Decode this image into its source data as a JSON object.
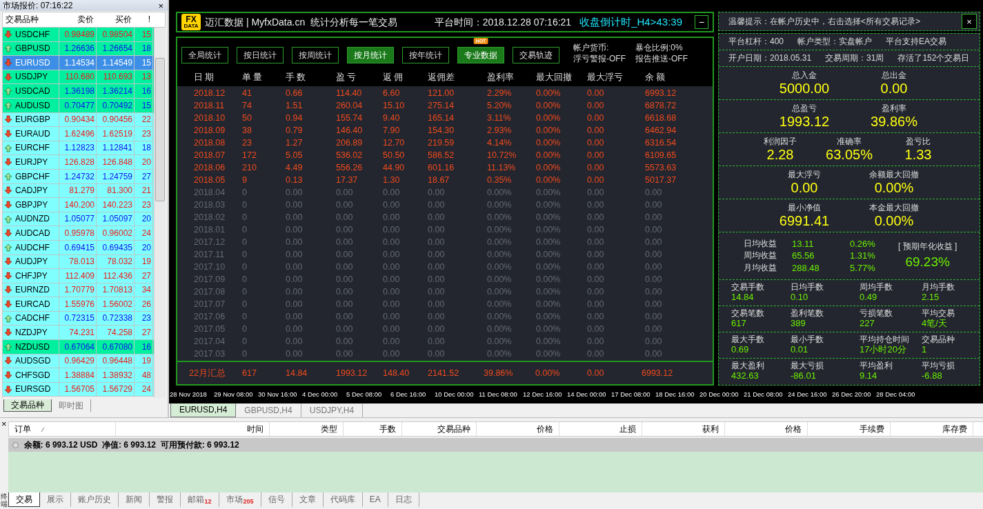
{
  "market_watch": {
    "title": "市场报价: 07:16:22",
    "close": "×",
    "columns": [
      "交易品种",
      "卖价",
      "买价",
      "!"
    ],
    "quotes": [
      {
        "symbol": "USDCHF",
        "bid": "0.98489",
        "ask": "0.98504",
        "spread": "15",
        "rising": false,
        "highlighted": true,
        "selected": false
      },
      {
        "symbol": "GBPUSD",
        "bid": "1.26636",
        "ask": "1.26654",
        "spread": "18",
        "rising": true,
        "highlighted": true,
        "selected": false
      },
      {
        "symbol": "EURUSD",
        "bid": "1.14534",
        "ask": "1.14549",
        "spread": "15",
        "rising": false,
        "selected": true
      },
      {
        "symbol": "USDJPY",
        "bid": "110.680",
        "ask": "110.693",
        "spread": "13",
        "rising": false,
        "highlighted": true,
        "selected": false
      },
      {
        "symbol": "USDCAD",
        "bid": "1.36198",
        "ask": "1.36214",
        "spread": "16",
        "rising": true,
        "highlighted": true,
        "selected": false
      },
      {
        "symbol": "AUDUSD",
        "bid": "0.70477",
        "ask": "0.70492",
        "spread": "15",
        "rising": true,
        "highlighted": true,
        "selected": false
      },
      {
        "symbol": "EURGBP",
        "bid": "0.90434",
        "ask": "0.90456",
        "spread": "22",
        "rising": false,
        "highlighted": false,
        "selected": false
      },
      {
        "symbol": "EURAUD",
        "bid": "1.62496",
        "ask": "1.62519",
        "spread": "23",
        "rising": false,
        "highlighted": false,
        "selected": false
      },
      {
        "symbol": "EURCHF",
        "bid": "1.12823",
        "ask": "1.12841",
        "spread": "18",
        "rising": true,
        "highlighted": false,
        "selected": false
      },
      {
        "symbol": "EURJPY",
        "bid": "126.828",
        "ask": "126.848",
        "spread": "20",
        "rising": false,
        "highlighted": false,
        "selected": false
      },
      {
        "symbol": "GBPCHF",
        "bid": "1.24732",
        "ask": "1.24759",
        "spread": "27",
        "rising": true,
        "highlighted": false,
        "selected": false
      },
      {
        "symbol": "CADJPY",
        "bid": "81.279",
        "ask": "81.300",
        "spread": "21",
        "rising": false,
        "highlighted": false,
        "selected": false
      },
      {
        "symbol": "GBPJPY",
        "bid": "140.200",
        "ask": "140.223",
        "spread": "23",
        "rising": false,
        "highlighted": false,
        "selected": false
      },
      {
        "symbol": "AUDNZD",
        "bid": "1.05077",
        "ask": "1.05097",
        "spread": "20",
        "rising": true,
        "highlighted": false,
        "selected": false
      },
      {
        "symbol": "AUDCAD",
        "bid": "0.95978",
        "ask": "0.96002",
        "spread": "24",
        "rising": false,
        "highlighted": false,
        "selected": false
      },
      {
        "symbol": "AUDCHF",
        "bid": "0.69415",
        "ask": "0.69435",
        "spread": "20",
        "rising": true,
        "highlighted": false,
        "selected": false
      },
      {
        "symbol": "AUDJPY",
        "bid": "78.013",
        "ask": "78.032",
        "spread": "19",
        "rising": false,
        "highlighted": false,
        "selected": false
      },
      {
        "symbol": "CHFJPY",
        "bid": "112.409",
        "ask": "112.436",
        "spread": "27",
        "rising": false,
        "highlighted": false,
        "selected": false
      },
      {
        "symbol": "EURNZD",
        "bid": "1.70779",
        "ask": "1.70813",
        "spread": "34",
        "rising": false,
        "highlighted": false,
        "selected": false
      },
      {
        "symbol": "EURCAD",
        "bid": "1.55976",
        "ask": "1.56002",
        "spread": "26",
        "rising": false,
        "highlighted": false,
        "selected": false
      },
      {
        "symbol": "CADCHF",
        "bid": "0.72315",
        "ask": "0.72338",
        "spread": "23",
        "rising": true,
        "highlighted": false,
        "selected": false
      },
      {
        "symbol": "NZDJPY",
        "bid": "74.231",
        "ask": "74.258",
        "spread": "27",
        "rising": false,
        "highlighted": false,
        "selected": false
      },
      {
        "symbol": "NZDUSD",
        "bid": "0.67064",
        "ask": "0.67080",
        "spread": "16",
        "rising": true,
        "highlighted": true,
        "selected": false
      },
      {
        "symbol": "AUDSGD",
        "bid": "0.96429",
        "ask": "0.96448",
        "spread": "19",
        "rising": false,
        "highlighted": false,
        "selected": false
      },
      {
        "symbol": "CHFSGD",
        "bid": "1.38884",
        "ask": "1.38932",
        "spread": "48",
        "rising": false,
        "highlighted": false,
        "selected": false
      },
      {
        "symbol": "EURSGD",
        "bid": "1.56705",
        "ask": "1.56729",
        "spread": "24",
        "rising": false,
        "highlighted": false,
        "selected": false
      }
    ],
    "tabs": [
      {
        "label": "交易品种",
        "selected": true
      },
      {
        "label": "即时图",
        "selected": false
      }
    ]
  },
  "header": {
    "logo_top": "FX",
    "logo_bottom": "DATA",
    "title": "迈汇数据 | MyfxData.cn  统计分析每一笔交易",
    "platform_time": "平台时间：2018.12.28 07:16:21",
    "countdown": "收盘倒计时_H4>43:39",
    "minimize": "−"
  },
  "toolbar": {
    "buttons": [
      {
        "label": "全局统计",
        "selected": false
      },
      {
        "label": "按日统计",
        "selected": false
      },
      {
        "label": "按周统计",
        "selected": false
      },
      {
        "label": "按月统计",
        "selected": true
      },
      {
        "label": "按年统计",
        "selected": false
      },
      {
        "label": "专业数据",
        "selected": true,
        "badge": "HOT"
      },
      {
        "label": "交易轨迹",
        "selected": false
      }
    ],
    "account": [
      "帐户货币:",
      "暴仓比例:0%",
      "浮亏警报-OFF",
      "报告推送-OFF"
    ]
  },
  "monthly_table": {
    "columns": [
      "日 期",
      "单 量",
      "手 数",
      "盈 亏",
      "返 佣",
      "返佣差",
      "盈利率",
      "最大回撤",
      "最大浮亏",
      "余 额"
    ],
    "rows": [
      {
        "cells": [
          "2018.12",
          "41",
          "0.66",
          "114.40",
          "6.60",
          "121.00",
          "2.29%",
          "0.00%",
          "0.00",
          "6993.12"
        ],
        "active": true
      },
      {
        "cells": [
          "2018.11",
          "74",
          "1.51",
          "260.04",
          "15.10",
          "275.14",
          "5.20%",
          "0.00%",
          "0.00",
          "6878.72"
        ],
        "active": true
      },
      {
        "cells": [
          "2018.10",
          "50",
          "0.94",
          "155.74",
          "9.40",
          "165.14",
          "3.11%",
          "0.00%",
          "0.00",
          "6618.68"
        ],
        "active": true
      },
      {
        "cells": [
          "2018.09",
          "38",
          "0.79",
          "146.40",
          "7.90",
          "154.30",
          "2.93%",
          "0.00%",
          "0.00",
          "6462.94"
        ],
        "active": true
      },
      {
        "cells": [
          "2018.08",
          "23",
          "1.27",
          "206.89",
          "12.70",
          "219.59",
          "4.14%",
          "0.00%",
          "0.00",
          "6316.54"
        ],
        "active": true
      },
      {
        "cells": [
          "2018.07",
          "172",
          "5.05",
          "536.02",
          "50.50",
          "586.52",
          "10.72%",
          "0.00%",
          "0.00",
          "6109.65"
        ],
        "active": true
      },
      {
        "cells": [
          "2018.06",
          "210",
          "4.49",
          "556.26",
          "44.90",
          "601.16",
          "11.13%",
          "0.00%",
          "0.00",
          "5573.63"
        ],
        "active": true
      },
      {
        "cells": [
          "2018.05",
          "9",
          "0.13",
          "17.37",
          "1.30",
          "18.67",
          "0.35%",
          "0.00%",
          "0.00",
          "5017.37"
        ],
        "active": true
      },
      {
        "cells": [
          "2018.04",
          "0",
          "0.00",
          "0.00",
          "0.00",
          "0.00",
          "0.00%",
          "0.00%",
          "0.00",
          "0.00"
        ],
        "active": false
      },
      {
        "cells": [
          "2018.03",
          "0",
          "0.00",
          "0.00",
          "0.00",
          "0.00",
          "0.00%",
          "0.00%",
          "0.00",
          "0.00"
        ],
        "active": false
      },
      {
        "cells": [
          "2018.02",
          "0",
          "0.00",
          "0.00",
          "0.00",
          "0.00",
          "0.00%",
          "0.00%",
          "0.00",
          "0.00"
        ],
        "active": false
      },
      {
        "cells": [
          "2018.01",
          "0",
          "0.00",
          "0.00",
          "0.00",
          "0.00",
          "0.00%",
          "0.00%",
          "0.00",
          "0.00"
        ],
        "active": false
      },
      {
        "cells": [
          "2017.12",
          "0",
          "0.00",
          "0.00",
          "0.00",
          "0.00",
          "0.00%",
          "0.00%",
          "0.00",
          "0.00"
        ],
        "active": false
      },
      {
        "cells": [
          "2017.11",
          "0",
          "0.00",
          "0.00",
          "0.00",
          "0.00",
          "0.00%",
          "0.00%",
          "0.00",
          "0.00"
        ],
        "active": false
      },
      {
        "cells": [
          "2017.10",
          "0",
          "0.00",
          "0.00",
          "0.00",
          "0.00",
          "0.00%",
          "0.00%",
          "0.00",
          "0.00"
        ],
        "active": false
      },
      {
        "cells": [
          "2017.09",
          "0",
          "0.00",
          "0.00",
          "0.00",
          "0.00",
          "0.00%",
          "0.00%",
          "0.00",
          "0.00"
        ],
        "active": false
      },
      {
        "cells": [
          "2017.08",
          "0",
          "0.00",
          "0.00",
          "0.00",
          "0.00",
          "0.00%",
          "0.00%",
          "0.00",
          "0.00"
        ],
        "active": false
      },
      {
        "cells": [
          "2017.07",
          "0",
          "0.00",
          "0.00",
          "0.00",
          "0.00",
          "0.00%",
          "0.00%",
          "0.00",
          "0.00"
        ],
        "active": false
      },
      {
        "cells": [
          "2017.06",
          "0",
          "0.00",
          "0.00",
          "0.00",
          "0.00",
          "0.00%",
          "0.00%",
          "0.00",
          "0.00"
        ],
        "active": false
      },
      {
        "cells": [
          "2017.05",
          "0",
          "0.00",
          "0.00",
          "0.00",
          "0.00",
          "0.00%",
          "0.00%",
          "0.00",
          "0.00"
        ],
        "active": false
      },
      {
        "cells": [
          "2017.04",
          "0",
          "0.00",
          "0.00",
          "0.00",
          "0.00",
          "0.00%",
          "0.00%",
          "0.00",
          "0.00"
        ],
        "active": false
      },
      {
        "cells": [
          "2017.03",
          "0",
          "0.00",
          "0.00",
          "0.00",
          "0.00",
          "0.00%",
          "0.00%",
          "0.00",
          "0.00"
        ],
        "active": false
      }
    ],
    "summary": [
      "22月汇总",
      "617",
      "14.84",
      "1993.12",
      "148.40",
      "2141.52",
      "39.86%",
      "0.00%",
      "0.00",
      "6993.12"
    ]
  },
  "stats_panel": {
    "tip": "温馨提示：在帐户历史中，右击选择<所有交易记录>",
    "close": "×",
    "info_rows": [
      [
        "平台杠杆：400",
        "帐户类型：实盘帐户",
        "平台支持EA交易"
      ],
      [
        "开户日期：2018.05.31",
        "交易周期：31周",
        "存活了152个交易日"
      ]
    ],
    "big_stats": [
      [
        {
          "label": "总入金",
          "value": "5000.00"
        },
        {
          "label": "总出金",
          "value": "0.00"
        }
      ],
      [
        {
          "label": "总盈亏",
          "value": "1993.12"
        },
        {
          "label": "盈利率",
          "value": "39.86%"
        }
      ],
      [
        {
          "label": "利润因子",
          "value": "2.28"
        },
        {
          "label": "准确率",
          "value": "63.05%"
        },
        {
          "label": "盈亏比",
          "value": "1.33"
        }
      ],
      [
        {
          "label": "最大浮亏",
          "value": "0.00"
        },
        {
          "label": "余额最大回撤",
          "value": "0.00%"
        }
      ],
      [
        {
          "label": "最小净值",
          "value": "6991.41"
        },
        {
          "label": "本金最大回撤",
          "value": "0.00%"
        }
      ]
    ],
    "returns": [
      {
        "label": "日均收益",
        "amount": "13.11",
        "percent": "0.26%"
      },
      {
        "label": "周均收益",
        "amount": "65.56",
        "percent": "1.31%"
      },
      {
        "label": "月均收益",
        "amount": "288.48",
        "percent": "5.77%"
      }
    ],
    "annual_label": "[ 预期年化收益 ]",
    "annual_value": "69.23%",
    "small_stats": [
      [
        {
          "label": "交易手数",
          "value": "14.84"
        },
        {
          "label": "日均手数",
          "value": "0.10"
        },
        {
          "label": "周均手数",
          "value": "0.49"
        },
        {
          "label": "月均手数",
          "value": "2.15"
        }
      ],
      [
        {
          "label": "交易笔数",
          "value": "617"
        },
        {
          "label": "盈利笔数",
          "value": "389"
        },
        {
          "label": "亏损笔数",
          "value": "227"
        },
        {
          "label": "平均交易",
          "value": "4笔/天"
        }
      ],
      [
        {
          "label": "最大手数",
          "value": "0.69"
        },
        {
          "label": "最小手数",
          "value": "0.01"
        },
        {
          "label": "平均持仓时间",
          "value": "17小时20分"
        },
        {
          "label": "交易品种",
          "value": "1"
        }
      ],
      [
        {
          "label": "最大盈利",
          "value": "432.63"
        },
        {
          "label": "最大亏损",
          "value": "-86.01"
        },
        {
          "label": "平均盈利",
          "value": "9.14"
        },
        {
          "label": "平均亏损",
          "value": "-6.88"
        }
      ]
    ]
  },
  "time_axis": [
    "28 Nov 2018",
    "29 Nov 08:00",
    "30 Nov 16:00",
    "4 Dec 00:00",
    "5 Dec 08:00",
    "6 Dec 16:00",
    "10 Dec 00:00",
    "11 Dec 08:00",
    "12 Dec 16:00",
    "14 Dec 00:00",
    "17 Dec 08:00",
    "18 Dec 16:00",
    "20 Dec 00:00",
    "21 Dec 08:00",
    "24 Dec 16:00",
    "26 Dec 20:00",
    "28 Dec 04:00"
  ],
  "chart_tabs": [
    {
      "label": "EURUSD,H4",
      "selected": true
    },
    {
      "label": "GBPUSD,H4",
      "selected": false
    },
    {
      "label": "USDJPY,H4",
      "selected": false
    }
  ],
  "terminal": {
    "side_label": "终端",
    "close": "×",
    "columns": [
      "订单",
      "时间",
      "类型",
      "手数",
      "交易品种",
      "价格",
      "止损",
      "获利",
      "价格",
      "手续费",
      "库存费"
    ],
    "summary": "余额: 6 993.12 USD  净值: 6 993.12  可用预付款: 6 993.12",
    "tabs": [
      {
        "label": "交易",
        "selected": true
      },
      {
        "label": "展示",
        "selected": false
      },
      {
        "label": "账户历史",
        "selected": false
      },
      {
        "label": "新闻",
        "selected": false
      },
      {
        "label": "警报",
        "selected": false
      },
      {
        "label": "邮箱",
        "selected": false,
        "badge": "12"
      },
      {
        "label": "市场",
        "selected": false,
        "badge": "205"
      },
      {
        "label": "信号",
        "selected": false
      },
      {
        "label": "文章",
        "selected": false
      },
      {
        "label": "代码库",
        "selected": false
      },
      {
        "label": "EA",
        "selected": false
      },
      {
        "label": "日志",
        "selected": false
      }
    ]
  }
}
